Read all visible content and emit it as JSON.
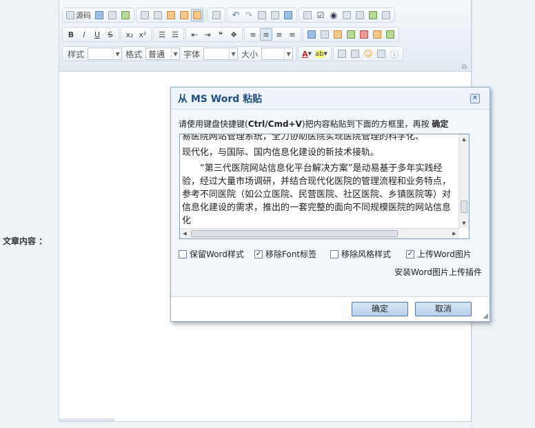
{
  "form": {
    "content_label": "文章内容 ："
  },
  "toolbar": {
    "source_label": "源码",
    "style_label": "样式",
    "format_label": "格式",
    "format_value": "普通",
    "font_label": "字体",
    "size_label": "大小",
    "bold_label": "B",
    "italic_label": "I",
    "underline_label": "U",
    "strike_label": "S",
    "sub_label": "x₂",
    "sup_label": "x²",
    "font_color_label": "A",
    "bg_color_label": "ab"
  },
  "dialog": {
    "title": "从 MS Word 粘贴",
    "close_label": "✕",
    "instruction_pre": "请使用键盘快捷键(",
    "instruction_keys": "Ctrl/Cmd+V",
    "instruction_mid": ")把内容粘贴到下面的方框里，再按 ",
    "instruction_ok": "确定",
    "paste_paragraphs": [
      "易医院网站管理系统，全力协助医院实现医院管理的科学化、",
      "现代化，与国际、国内信息化建设的新技术接轨。",
      "“第三代医院网站信息化平台解决方案”是动易基于多年实践经验，经过大量市场调研，并结合现代化医院的管理流程和业务特点，参考不同医院（如公立医院、民营医院、社区医院、乡镇医院等）对信息化建设的需求，推出的一套完整的面向不同规模医院的网站信息化"
    ],
    "options": [
      {
        "label": "保留Word样式",
        "checked": false
      },
      {
        "label": "移除Font标签",
        "checked": true
      },
      {
        "label": "移除风格样式",
        "checked": false
      },
      {
        "label": "上传Word图片",
        "checked": true
      }
    ],
    "install_link": "安装Word图片上传插件",
    "ok_label": "确定",
    "cancel_label": "取消"
  }
}
